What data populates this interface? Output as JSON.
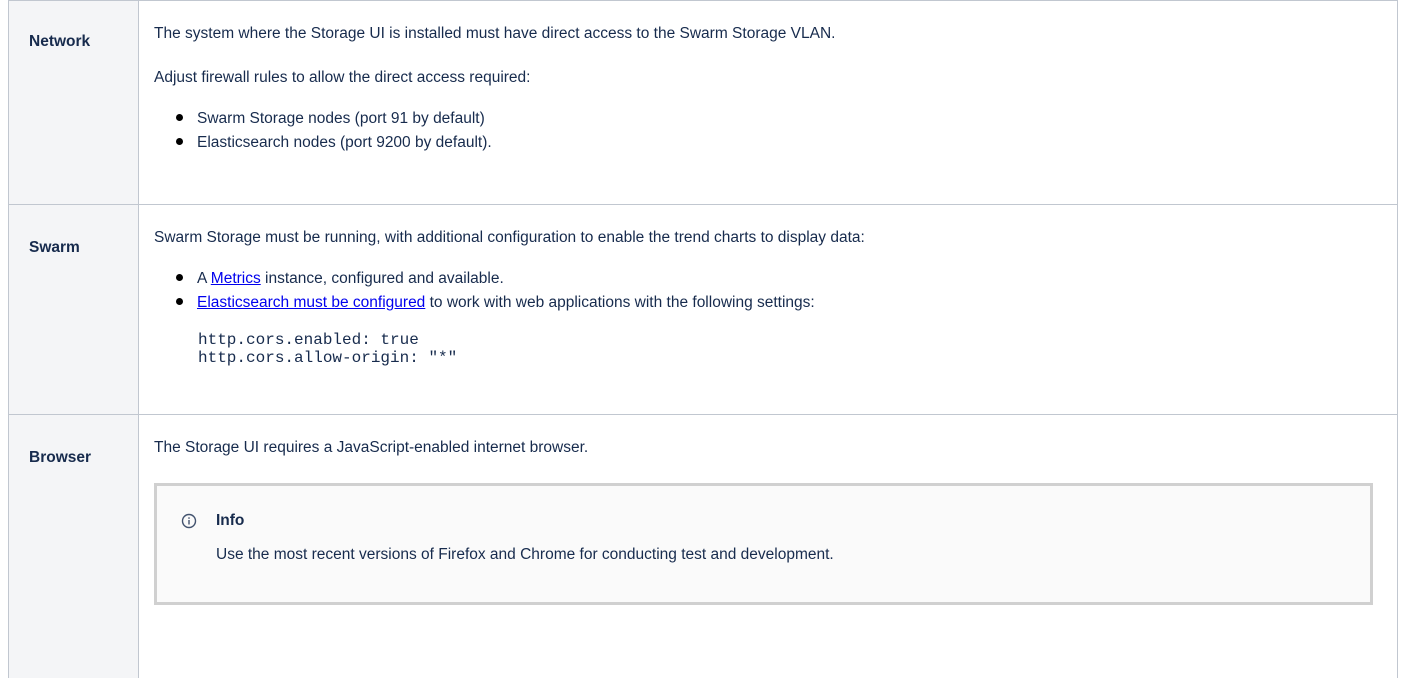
{
  "rows": [
    {
      "label": "Network",
      "intro": "The system where the Storage UI is installed must have direct access to the Swarm Storage VLAN.",
      "second": "Adjust firewall rules to allow the direct access required:",
      "bullets": [
        "Swarm Storage nodes (port 91 by default)",
        "Elasticsearch nodes (port 9200 by default)."
      ]
    },
    {
      "label": "Swarm",
      "intro": "Swarm Storage must be running, with additional configuration to enable the trend charts to display data:",
      "bullet1": {
        "prefix": "A ",
        "link": "Metrics",
        "suffix": " instance, configured and available."
      },
      "bullet2": {
        "link": "Elasticsearch must be configured",
        "suffix": " to work with web applications with the following settings:"
      },
      "code": [
        "http.cors.enabled: true",
        "http.cors.allow-origin: \"*\""
      ]
    },
    {
      "label": "Browser",
      "intro": "The Storage UI requires a JavaScript-enabled internet browser.",
      "info": {
        "icon": "info-circle-icon",
        "title": "Info",
        "text": "Use the most recent versions of Firefox and Chrome for conducting test and development."
      }
    }
  ],
  "colors": {
    "label_bg": "#f4f5f7",
    "border": "#c1c7d0",
    "link": "#0000ee",
    "info_border": "#d0d0d0",
    "info_bg": "#fafafa"
  }
}
